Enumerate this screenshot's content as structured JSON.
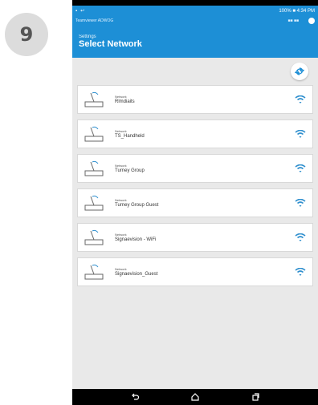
{
  "step_badge": "9",
  "status_bar": {
    "left_icons": [
      "screenshot-icon",
      "notification-icon"
    ],
    "right_text": "100% ■ 4:34 PM"
  },
  "notification": {
    "left_text": "Teamviewer ADWOG",
    "mid_text": "■■ ■■"
  },
  "header": {
    "crumb": "Settings",
    "title": "Select Network"
  },
  "network_label": "Network",
  "networks": [
    {
      "name": "Rlmdiaits"
    },
    {
      "name": "TS_Handheld"
    },
    {
      "name": "Turney Group"
    },
    {
      "name": "Turney Group Guest"
    },
    {
      "name": "Signaevision - WiFi"
    },
    {
      "name": "Signaevision_Guest"
    }
  ],
  "colors": {
    "accent": "#1d8fd6",
    "list_bg": "#e9e9e9",
    "wifi": "#2f8fce"
  }
}
